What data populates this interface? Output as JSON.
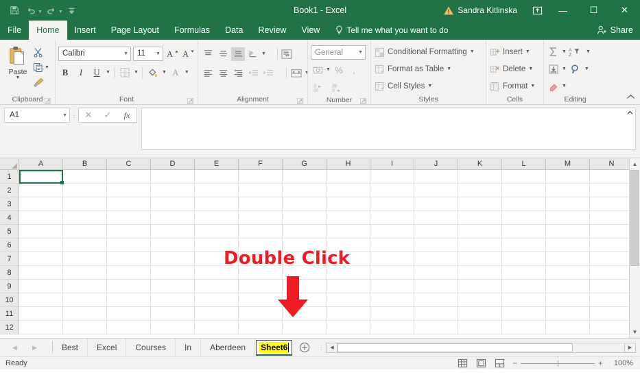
{
  "titlebar": {
    "document_title": "Book1 - Excel",
    "user_name": "Sandra  Kitlinska",
    "qat": [
      {
        "name": "save",
        "label": "Save"
      },
      {
        "name": "undo",
        "label": "Undo"
      },
      {
        "name": "redo",
        "label": "Redo"
      },
      {
        "name": "customize",
        "label": "Customize Quick Access Toolbar"
      }
    ],
    "window_controls": {
      "minimize": "—",
      "maximize": "☐",
      "close": "✕"
    },
    "brand_color": "#217346"
  },
  "ribbon_tabs": {
    "items": [
      "File",
      "Home",
      "Insert",
      "Page Layout",
      "Formulas",
      "Data",
      "Review",
      "View"
    ],
    "active": "Home",
    "tell_me": "Tell me what you want to do",
    "share": "Share"
  },
  "ribbon": {
    "clipboard": {
      "group_label": "Clipboard",
      "paste_label": "Paste",
      "buttons": [
        "Cut",
        "Copy",
        "Format Painter"
      ]
    },
    "font": {
      "group_label": "Font",
      "font_name": "Calibri",
      "font_size": "11",
      "grow_label": "A",
      "shrink_label": "A",
      "bold": "B",
      "italic": "I",
      "underline": "U",
      "borders": "Borders",
      "fill_color": "Fill Color",
      "font_color": "A"
    },
    "alignment": {
      "group_label": "Alignment",
      "buttons": [
        "Top Align",
        "Middle Align",
        "Bottom Align",
        "Orientation",
        "Align Left",
        "Center",
        "Align Right",
        "Decrease Indent",
        "Increase Indent",
        "Wrap Text",
        "Merge & Center"
      ]
    },
    "number": {
      "group_label": "Number",
      "format": "General",
      "buttons": [
        "Accounting Number Format",
        "Percent Style",
        "Comma Style",
        "Increase Decimal",
        "Decrease Decimal"
      ]
    },
    "styles": {
      "group_label": "Styles",
      "items": [
        "Conditional Formatting",
        "Format as Table",
        "Cell Styles"
      ]
    },
    "cells": {
      "group_label": "Cells",
      "items": [
        "Insert",
        "Delete",
        "Format"
      ]
    },
    "editing": {
      "group_label": "Editing",
      "items": [
        "AutoSum",
        "Sort & Filter",
        "Fill",
        "Find & Select",
        "Clear"
      ]
    },
    "collapse_label": "Collapse the Ribbon"
  },
  "formula_bar": {
    "name_box": "A1",
    "cancel": "✕",
    "enter": "✓",
    "insert_function": "fx",
    "value": "",
    "collapse": "Collapse Formula Bar"
  },
  "grid": {
    "columns": [
      "A",
      "B",
      "C",
      "D",
      "E",
      "F",
      "G",
      "H",
      "I",
      "J",
      "K",
      "L",
      "M",
      "N"
    ],
    "rows": [
      "1",
      "2",
      "3",
      "4",
      "5",
      "6",
      "7",
      "8",
      "9",
      "10",
      "11",
      "12"
    ],
    "selected_cell": "A1",
    "cells": {}
  },
  "annotation": {
    "text": "Double Click",
    "color": "#ee1c25",
    "arrow": "down-arrow"
  },
  "sheet_tabs": {
    "nav_prev": "◀",
    "nav_next": "▶",
    "tabs": [
      {
        "label": "Best",
        "active": false,
        "editing": false
      },
      {
        "label": "Excel",
        "active": false,
        "editing": false
      },
      {
        "label": "Courses",
        "active": false,
        "editing": false
      },
      {
        "label": "In",
        "active": false,
        "editing": false
      },
      {
        "label": "Aberdeen",
        "active": false,
        "editing": false
      },
      {
        "label": "Sheet6",
        "active": true,
        "editing": true
      }
    ],
    "editing_tab_label": "Sheet6",
    "add_sheet": "New sheet",
    "selection_highlight": "#ffff00"
  },
  "status_bar": {
    "state": "Ready",
    "views": [
      "Normal",
      "Page Layout",
      "Page Break Preview"
    ],
    "zoom_out": "−",
    "zoom_in": "+",
    "zoom_level": "100%"
  }
}
